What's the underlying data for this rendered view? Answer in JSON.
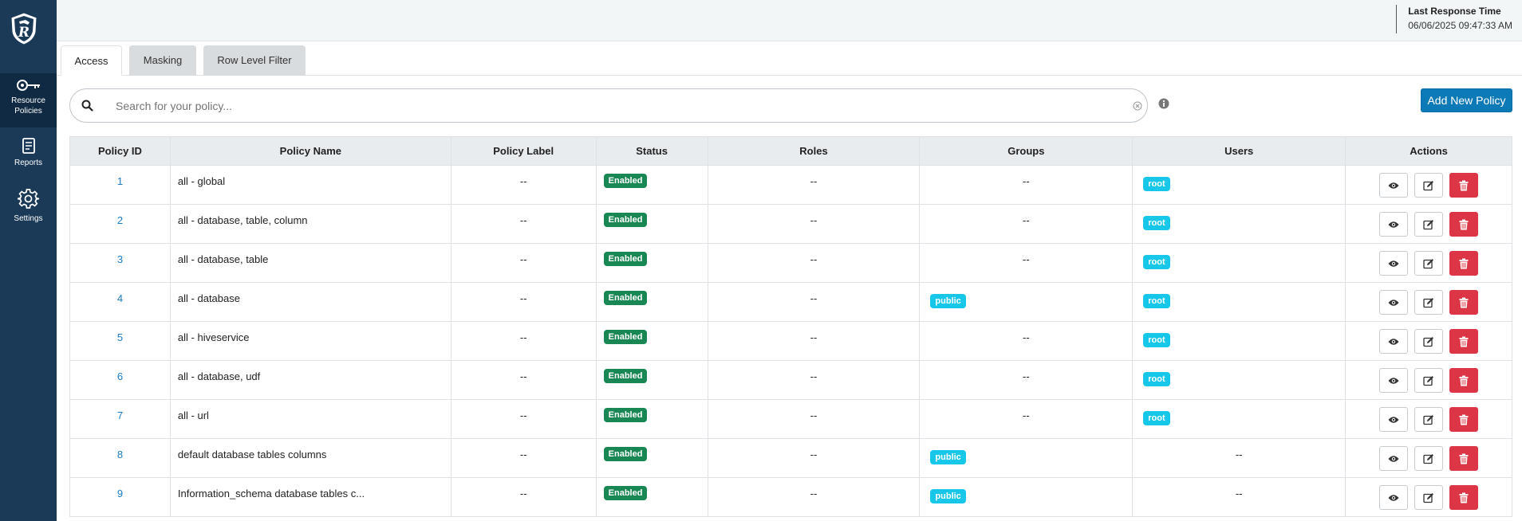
{
  "sidebar": {
    "items": [
      {
        "label_line1": "Resource",
        "label_line2": "Policies",
        "icon": "key-icon",
        "active": true
      },
      {
        "label": "Reports",
        "icon": "report-icon"
      },
      {
        "label": "Settings",
        "icon": "gear-icon"
      }
    ]
  },
  "header": {
    "response_title": "Last Response Time",
    "response_time": "06/06/2025 09:47:33 AM"
  },
  "tabs": [
    {
      "label": "Access",
      "active": true
    },
    {
      "label": "Masking"
    },
    {
      "label": "Row Level Filter"
    }
  ],
  "search": {
    "placeholder": "Search for your policy..."
  },
  "toolbar": {
    "add_label": "Add New Policy"
  },
  "table": {
    "columns": [
      "Policy ID",
      "Policy Name",
      "Policy Label",
      "Status",
      "Roles",
      "Groups",
      "Users",
      "Actions"
    ],
    "rows": [
      {
        "id": "1",
        "name": "all - global",
        "label": "--",
        "status": "Enabled",
        "roles": "--",
        "groups": "--",
        "users": "root"
      },
      {
        "id": "2",
        "name": "all - database, table, column",
        "label": "--",
        "status": "Enabled",
        "roles": "--",
        "groups": "--",
        "users": "root"
      },
      {
        "id": "3",
        "name": "all - database, table",
        "label": "--",
        "status": "Enabled",
        "roles": "--",
        "groups": "--",
        "users": "root"
      },
      {
        "id": "4",
        "name": "all - database",
        "label": "--",
        "status": "Enabled",
        "roles": "--",
        "groups": "public",
        "users": "root"
      },
      {
        "id": "5",
        "name": "all - hiveservice",
        "label": "--",
        "status": "Enabled",
        "roles": "--",
        "groups": "--",
        "users": "root"
      },
      {
        "id": "6",
        "name": "all - database, udf",
        "label": "--",
        "status": "Enabled",
        "roles": "--",
        "groups": "--",
        "users": "root"
      },
      {
        "id": "7",
        "name": "all - url",
        "label": "--",
        "status": "Enabled",
        "roles": "--",
        "groups": "--",
        "users": "root"
      },
      {
        "id": "8",
        "name": "default database tables columns",
        "label": "--",
        "status": "Enabled",
        "roles": "--",
        "groups": "public",
        "users": "--"
      },
      {
        "id": "9",
        "name": "Information_schema database tables c...",
        "label": "--",
        "status": "Enabled",
        "roles": "--",
        "groups": "public",
        "users": "--"
      }
    ]
  },
  "colors": {
    "sidebar_bg": "#1b3a57",
    "enabled": "#198754",
    "info_badge": "#16c7ea",
    "primary": "#0d7ab8",
    "danger": "#dc3545",
    "link": "#1a7cc4"
  }
}
